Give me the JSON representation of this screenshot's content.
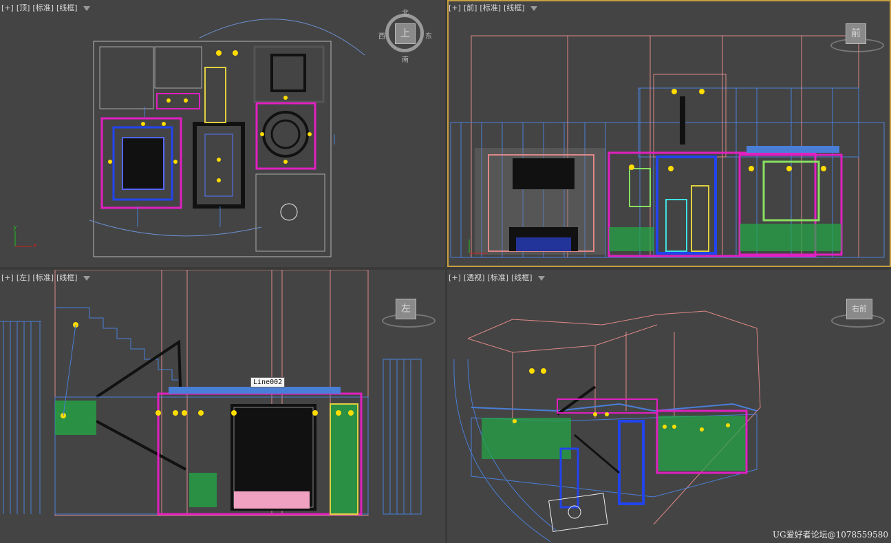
{
  "viewports": {
    "top": {
      "plus": "[+]",
      "view": "[顶]",
      "shading": "[标准]",
      "mode": "[线框]"
    },
    "front": {
      "plus": "[+]",
      "view": "[前]",
      "shading": "[标准]",
      "mode": "[线框]"
    },
    "left": {
      "plus": "[+]",
      "view": "[左]",
      "shading": "[标准]",
      "mode": "[线框]"
    },
    "persp": {
      "plus": "[+]",
      "view": "[透视]",
      "shading": "[标准]",
      "mode": "[线框]"
    }
  },
  "viewcube": {
    "top": {
      "face": "上",
      "north": "北",
      "south": "南",
      "east": "东",
      "west": "西"
    },
    "front": {
      "face": "前"
    },
    "left": {
      "face": "左"
    },
    "persp": {
      "face": "右前"
    }
  },
  "axis": {
    "x": "x",
    "y": "y"
  },
  "tooltip": {
    "text": "Line002"
  },
  "watermark": {
    "text": "UG爱好者论坛@1078559580"
  },
  "colors": {
    "viewport_bg": "#444444",
    "active_border": "#c8a040",
    "wire_pink": "#e08888",
    "wire_blue": "#4a7fd8",
    "wire_green": "#22aa44",
    "wire_yellow": "#ffdd00",
    "wire_magenta": "#e020c0",
    "wire_cyan": "#40e0e0"
  },
  "icons": {
    "filter": "filter-icon"
  }
}
